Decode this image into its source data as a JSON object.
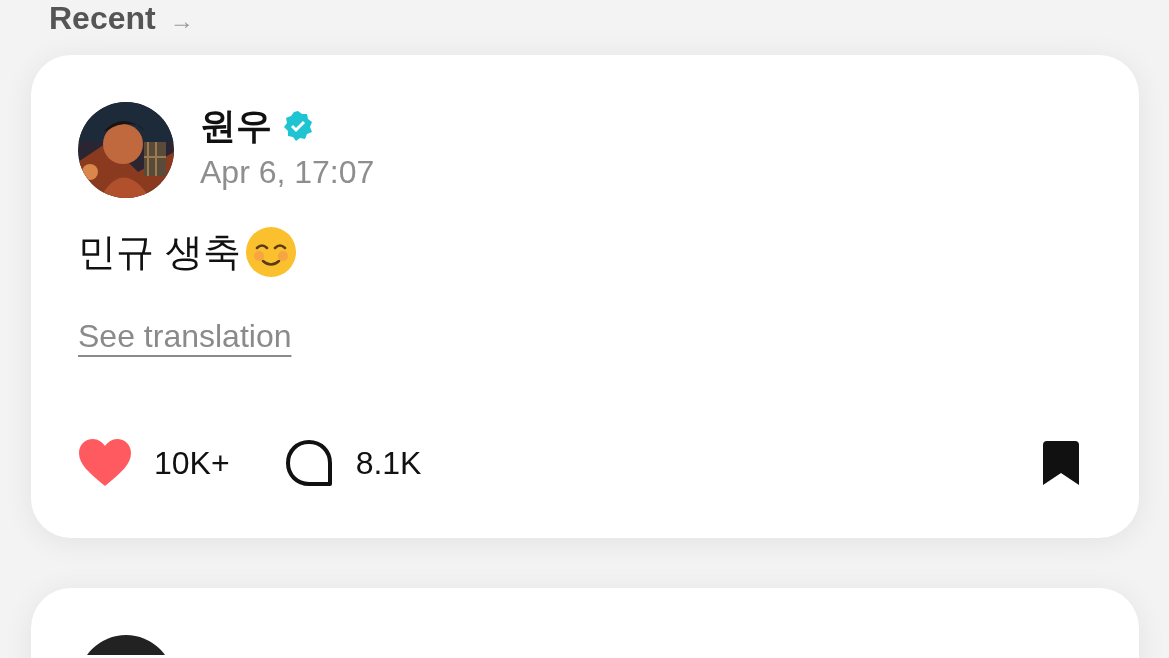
{
  "section": {
    "title": "Recent",
    "arrow": "→"
  },
  "posts": [
    {
      "author": "원우",
      "verified": true,
      "time": "Apr 6, 17:07",
      "text": "민규 생축",
      "emoji": true,
      "translate_link": "See translation",
      "likes": "10K+",
      "liked": true,
      "comments": "8.1K",
      "bookmarked": true
    },
    {
      "kind": "partial"
    }
  ]
}
